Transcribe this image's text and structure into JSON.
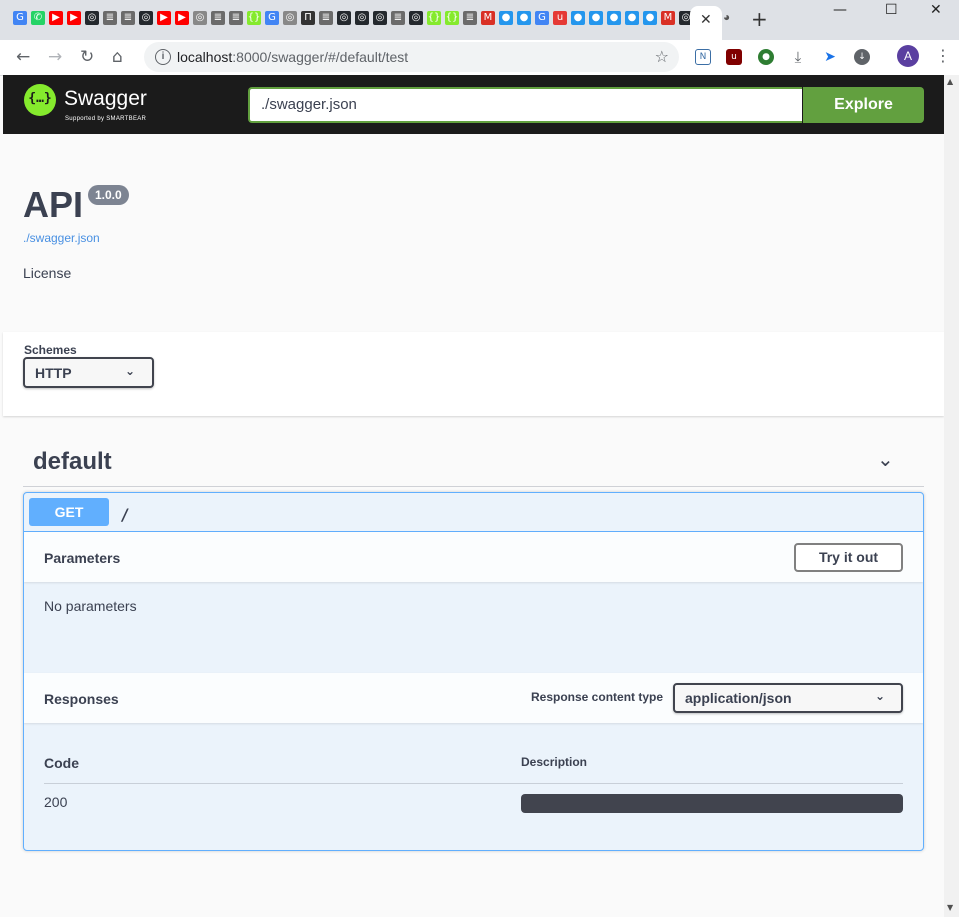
{
  "browser": {
    "tab_icons": [
      {
        "icon": "google-translate-icon",
        "color": "#4285f4",
        "glyph": "G"
      },
      {
        "icon": "whatsapp-icon",
        "color": "#25d366",
        "glyph": "✆"
      },
      {
        "icon": "youtube-icon",
        "color": "#ff0000",
        "glyph": "▶"
      },
      {
        "icon": "youtube-icon",
        "color": "#ff0000",
        "glyph": "▶"
      },
      {
        "icon": "github-icon",
        "color": "#24292e",
        "glyph": "◎"
      },
      {
        "icon": "document-icon",
        "color": "#6b6b6b",
        "glyph": "≣"
      },
      {
        "icon": "document-icon",
        "color": "#6b6b6b",
        "glyph": "≣"
      },
      {
        "icon": "github-icon",
        "color": "#24292e",
        "glyph": "◎"
      },
      {
        "icon": "youtube-icon",
        "color": "#ff0000",
        "glyph": "▶"
      },
      {
        "icon": "youtube-icon",
        "color": "#ff0000",
        "glyph": "▶"
      },
      {
        "icon": "circle-icon",
        "color": "#888888",
        "glyph": "◎"
      },
      {
        "icon": "document-icon",
        "color": "#6b6b6b",
        "glyph": "≣"
      },
      {
        "icon": "document-icon",
        "color": "#6b6b6b",
        "glyph": "≣"
      },
      {
        "icon": "swagger-icon",
        "color": "#85ea2d",
        "glyph": "{}"
      },
      {
        "icon": "google-icon",
        "color": "#4285f4",
        "glyph": "G"
      },
      {
        "icon": "circle-icon",
        "color": "#888888",
        "glyph": "◎"
      },
      {
        "icon": "pi-icon",
        "color": "#333333",
        "glyph": "Π"
      },
      {
        "icon": "document-icon",
        "color": "#6b6b6b",
        "glyph": "≣"
      },
      {
        "icon": "github-icon",
        "color": "#24292e",
        "glyph": "◎"
      },
      {
        "icon": "github-icon",
        "color": "#24292e",
        "glyph": "◎"
      },
      {
        "icon": "github-icon",
        "color": "#24292e",
        "glyph": "◎"
      },
      {
        "icon": "document-icon",
        "color": "#6b6b6b",
        "glyph": "≣"
      },
      {
        "icon": "github-icon",
        "color": "#24292e",
        "glyph": "◎"
      },
      {
        "icon": "swagger-icon",
        "color": "#85ea2d",
        "glyph": "{}"
      },
      {
        "icon": "swagger-icon",
        "color": "#85ea2d",
        "glyph": "{}"
      },
      {
        "icon": "document-icon",
        "color": "#6b6b6b",
        "glyph": "≣"
      },
      {
        "icon": "gmail-icon",
        "color": "#d93025",
        "glyph": "M"
      },
      {
        "icon": "docker-icon",
        "color": "#2496ed",
        "glyph": "●"
      },
      {
        "icon": "docker-icon",
        "color": "#2496ed",
        "glyph": "●"
      },
      {
        "icon": "google-icon",
        "color": "#4285f4",
        "glyph": "G"
      },
      {
        "icon": "u-icon",
        "color": "#e53935",
        "glyph": "u"
      },
      {
        "icon": "docker-icon",
        "color": "#2496ed",
        "glyph": "●"
      },
      {
        "icon": "docker-icon",
        "color": "#2496ed",
        "glyph": "●"
      },
      {
        "icon": "docker-icon",
        "color": "#2496ed",
        "glyph": "●"
      },
      {
        "icon": "docker-icon",
        "color": "#2496ed",
        "glyph": "●"
      },
      {
        "icon": "docker-icon",
        "color": "#2496ed",
        "glyph": "●"
      },
      {
        "icon": "gmail-icon",
        "color": "#d93025",
        "glyph": "M"
      },
      {
        "icon": "github-icon",
        "color": "#24292e",
        "glyph": "◎"
      }
    ],
    "active_tab_close": "✕",
    "new_tab": "+",
    "address": {
      "host": "localhost",
      "rest": ":8000/swagger/#/default/test"
    },
    "avatar_letter": "A"
  },
  "topbar": {
    "brand": "Swagger",
    "brand_sub": "Supported by SMARTBEAR",
    "url_value": "./swagger.json",
    "explore_label": "Explore",
    "accent": "#62a03f"
  },
  "info": {
    "title": "API",
    "version": "1.0.0",
    "spec_link": "./swagger.json",
    "license": "License"
  },
  "schemes": {
    "label": "Schemes",
    "selected": "HTTP"
  },
  "tag": {
    "name": "default"
  },
  "operation": {
    "method": "GET",
    "path": "/",
    "method_color": "#61affe",
    "parameters_title": "Parameters",
    "try_it_out": "Try it out",
    "no_parameters": "No parameters",
    "responses_title": "Responses",
    "content_type_label": "Response content type",
    "content_type_value": "application/json",
    "columns": {
      "code": "Code",
      "description": "Description"
    },
    "responses": [
      {
        "code": "200",
        "description": ""
      }
    ]
  }
}
